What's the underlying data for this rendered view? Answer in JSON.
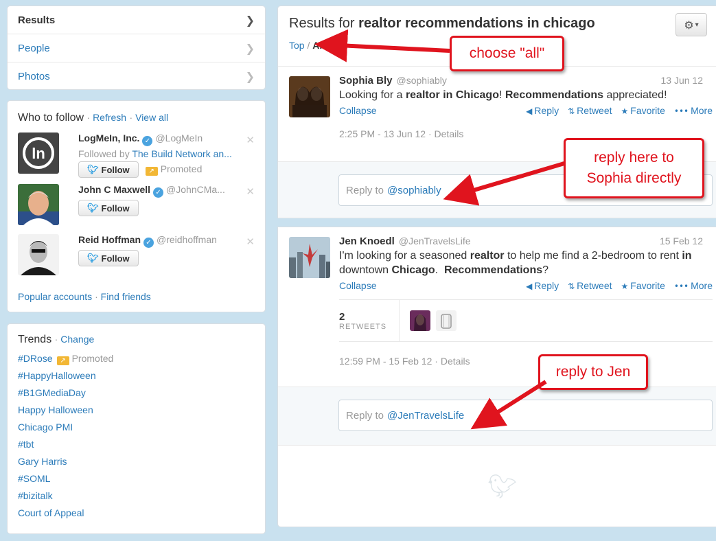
{
  "nav": {
    "items": [
      {
        "label": "Results",
        "active": true
      },
      {
        "label": "People",
        "active": false
      },
      {
        "label": "Photos",
        "active": false
      }
    ]
  },
  "who_to_follow": {
    "title": "Who to follow",
    "refresh": "Refresh",
    "view_all": "View all",
    "follow_label": "Follow",
    "promoted_label": "Promoted",
    "accounts": [
      {
        "name": "LogMeIn, Inc.",
        "handle": "@LogMeIn",
        "sub_prefix": "Followed by",
        "sub_link": "The Build Network an..."
      },
      {
        "name": "John C Maxwell",
        "handle": "@JohnCMa..."
      },
      {
        "name": "Reid Hoffman",
        "handle": "@reidhoffman"
      }
    ],
    "popular": "Popular accounts",
    "find_friends": "Find friends"
  },
  "trends": {
    "title": "Trends",
    "change": "Change",
    "promoted_label": "Promoted",
    "items": [
      "#DRose",
      "#HappyHalloween",
      "#B1GMediaDay",
      "Happy Halloween",
      "Chicago PMI",
      "#tbt",
      "Gary Harris",
      "#SOML",
      "#bizitalk",
      "Court of Appeal"
    ]
  },
  "main": {
    "title_prefix": "Results for",
    "query": "realtor recommendations in chicago",
    "subnav": {
      "top": "Top",
      "all": "All"
    }
  },
  "tweets": [
    {
      "fullname": "Sophia Bly",
      "username": "@sophiably",
      "date": "13 Jun 12",
      "text_parts": [
        "Looking for a ",
        "realtor in Chicago",
        "! ",
        "Recommendations",
        " appreciated!"
      ],
      "collapse": "Collapse",
      "actions": {
        "reply": "Reply",
        "retweet": "Retweet",
        "favorite": "Favorite",
        "more": "More"
      },
      "timestamp": "2:25 PM - 13 Jun 12",
      "details": "Details",
      "reply_prefix": "Reply to",
      "reply_to": "@sophiably"
    },
    {
      "fullname": "Jen Knoedl",
      "username": "@JenTravelsLife",
      "date": "15 Feb 12",
      "text_parts": [
        "I'm looking for a seasoned ",
        "realtor",
        " to help me find a 2-bedroom to rent ",
        "in",
        " downtown ",
        "Chicago",
        ".  ",
        "Recommendations",
        "?"
      ],
      "collapse": "Collapse",
      "actions": {
        "reply": "Reply",
        "retweet": "Retweet",
        "favorite": "Favorite",
        "more": "More"
      },
      "retweets_count": "2",
      "retweets_label": "RETWEETS",
      "timestamp": "12:59 PM - 15 Feb 12",
      "details": "Details",
      "reply_prefix": "Reply to",
      "reply_to": "@JenTravelsLife"
    }
  ],
  "annotations": {
    "choose_all": "choose \"all\"",
    "reply_sophia_line1": "reply here to",
    "reply_sophia_line2": "Sophia directly",
    "reply_jen": "reply to Jen",
    "color": "#e0141e"
  }
}
